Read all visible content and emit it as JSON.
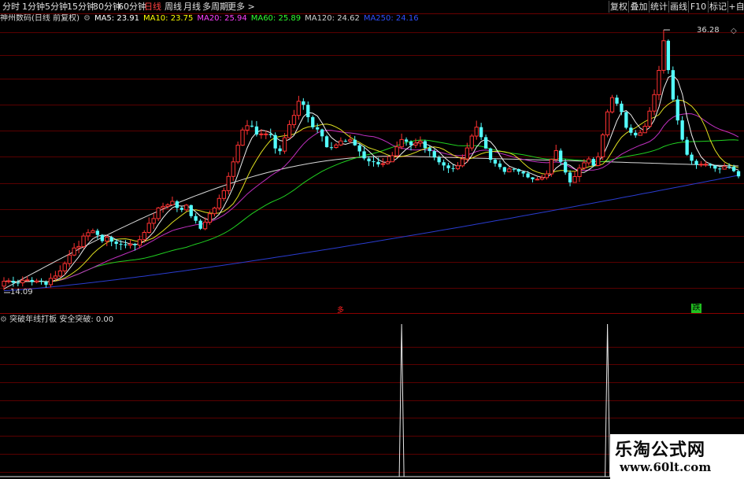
{
  "toolbar": {
    "tabs": [
      "分时",
      "1分钟",
      "5分钟",
      "15分钟",
      "30分钟",
      "60分钟",
      "日线",
      "周线",
      "月线",
      "多周期",
      "更多 >"
    ],
    "active_tab": "日线",
    "right_buttons": [
      "复权",
      "叠加",
      "统计",
      "画线",
      "F10",
      "标记",
      "+自选"
    ]
  },
  "stock": {
    "title": "神州数码(日线 前复权)"
  },
  "ma": [
    {
      "label": "MA5: 23.91",
      "color": "#ffffff"
    },
    {
      "label": "MA10: 23.75",
      "color": "#ffff00"
    },
    {
      "label": "MA20: 25.94",
      "color": "#ff00ff"
    },
    {
      "label": "MA60: 25.89",
      "color": "#00ff00"
    },
    {
      "label": "MA120: 24.62",
      "color": "#d0d0d0"
    },
    {
      "label": "MA250: 24.16",
      "color": "#3050ff"
    }
  ],
  "price_labels": {
    "high": "36.28",
    "low": "14.09"
  },
  "markers": {
    "buy": "多",
    "sell": "跌"
  },
  "indicator": {
    "label": "突破年线打板 安全突破: 0.00",
    "spikes": [
      {
        "candle": 85
      },
      {
        "candle": 129
      }
    ]
  },
  "colors": {
    "up": "#ff3232",
    "down": "#54ffff",
    "grid": "#5a0000",
    "ma250": "#2a3cd0"
  },
  "watermark": {
    "line1": "乐淘公式网",
    "line2": "www.60lt.com"
  },
  "chart_data": {
    "type": "candlestick",
    "y_high": 36.28,
    "y_low": 14.09,
    "candles": [
      [
        14.64,
        15.05,
        15.39,
        14.3
      ],
      [
        15.05,
        15.08,
        15.31,
        14.85
      ],
      [
        15.08,
        14.92,
        15.43,
        14.59
      ],
      [
        14.92,
        14.91,
        15.18,
        14.62
      ],
      [
        14.91,
        15.13,
        15.46,
        14.61
      ],
      [
        15.13,
        15.16,
        15.48,
        15.02
      ],
      [
        15.16,
        14.98,
        15.4,
        14.69
      ],
      [
        14.98,
        15.07,
        15.26,
        14.87
      ],
      [
        15.07,
        15.01,
        15.3,
        14.76
      ],
      [
        15.01,
        14.76,
        15.11,
        14.51
      ],
      [
        14.76,
        15.29,
        15.72,
        14.52
      ],
      [
        15.29,
        15.49,
        15.92,
        15.09
      ],
      [
        15.49,
        15.92,
        16.39,
        15.37
      ],
      [
        15.92,
        16.54,
        16.72,
        15.58
      ],
      [
        16.54,
        17.26,
        17.67,
        16.24
      ],
      [
        17.26,
        17.86,
        18.27,
        17.17
      ],
      [
        17.86,
        17.98,
        18.47,
        17.4
      ],
      [
        17.98,
        18.87,
        19.12,
        17.81
      ],
      [
        18.87,
        19.15,
        19.45,
        18.48
      ],
      [
        19.15,
        19.31,
        19.5,
        19.12
      ],
      [
        19.31,
        18.96,
        19.48,
        18.62
      ],
      [
        18.96,
        18.44,
        19.03,
        18.29
      ],
      [
        18.44,
        18.77,
        18.93,
        18.02
      ],
      [
        18.77,
        18.4,
        18.89,
        18.01
      ],
      [
        18.4,
        18.2,
        18.61,
        17.74
      ],
      [
        18.2,
        18.16,
        18.52,
        17.68
      ],
      [
        18.16,
        18.09,
        18.52,
        17.84
      ],
      [
        18.09,
        18.19,
        18.57,
        17.81
      ],
      [
        18.19,
        18.09,
        18.29,
        17.64
      ],
      [
        18.09,
        18.56,
        18.91,
        17.83
      ],
      [
        18.56,
        19.17,
        19.36,
        18.3
      ],
      [
        19.17,
        19.94,
        20.44,
        19.08
      ],
      [
        19.94,
        20.34,
        20.81,
        19.47
      ],
      [
        20.34,
        21.24,
        21.33,
        20.14
      ],
      [
        21.24,
        21.37,
        21.68,
        20.84
      ],
      [
        21.37,
        21.5,
        21.64,
        21.18
      ],
      [
        21.5,
        21.8,
        22.2,
        21.51
      ],
      [
        21.8,
        21.25,
        21.91,
        20.89
      ],
      [
        21.25,
        21.08,
        21.38,
        20.89
      ],
      [
        21.08,
        21.48,
        21.58,
        20.93
      ],
      [
        21.48,
        20.55,
        21.52,
        20.38
      ],
      [
        20.55,
        20.16,
        20.79,
        19.92
      ],
      [
        20.16,
        19.48,
        20.3,
        19.39
      ],
      [
        19.48,
        20.04,
        20.44,
        19.36
      ],
      [
        20.04,
        20.75,
        21.02,
        19.82
      ],
      [
        20.75,
        21.23,
        21.34,
        20.52
      ],
      [
        21.23,
        22.04,
        22.37,
        21.04
      ],
      [
        22.04,
        22.7,
        22.96,
        21.82
      ],
      [
        22.7,
        23.9,
        24.25,
        22.37
      ],
      [
        23.9,
        25.13,
        25.51,
        23.53
      ],
      [
        25.13,
        26.54,
        26.85,
        24.96
      ],
      [
        26.54,
        27.82,
        28.04,
        26.47
      ],
      [
        27.82,
        28.19,
        28.66,
        27.42
      ],
      [
        28.19,
        28.12,
        28.62,
        28.03
      ],
      [
        28.12,
        27.44,
        28.58,
        27.28
      ],
      [
        27.44,
        27.49,
        27.91,
        27.08
      ],
      [
        27.49,
        27.49,
        27.79,
        27.05
      ],
      [
        27.49,
        27.4,
        27.94,
        27.17
      ],
      [
        27.4,
        26.27,
        27.62,
        25.83
      ],
      [
        26.27,
        26.04,
        26.53,
        25.73
      ],
      [
        26.04,
        27.17,
        27.57,
        25.81
      ],
      [
        27.17,
        28.28,
        28.64,
        27.16
      ],
      [
        28.28,
        29.06,
        29.52,
        27.97
      ],
      [
        29.06,
        30.25,
        30.71,
        28.69
      ],
      [
        30.25,
        29.95,
        30.51,
        29.53
      ],
      [
        29.95,
        28.91,
        30.23,
        28.47
      ],
      [
        28.91,
        28.05,
        29.06,
        27.89
      ],
      [
        28.05,
        27.87,
        28.38,
        27.58
      ],
      [
        27.87,
        27.29,
        27.94,
        26.85
      ],
      [
        27.29,
        26.37,
        27.41,
        26.33
      ],
      [
        26.37,
        26.35,
        26.8,
        26.13
      ],
      [
        26.35,
        26.56,
        26.72,
        26.25
      ],
      [
        26.56,
        26.9,
        27.2,
        26.47
      ],
      [
        26.9,
        26.89,
        27.06,
        26.8
      ],
      [
        26.89,
        27.0,
        27.44,
        26.71
      ],
      [
        27.0,
        26.53,
        27.32,
        26.48
      ],
      [
        26.53,
        26.02,
        26.7,
        25.6
      ],
      [
        26.02,
        25.42,
        26.46,
        25.27
      ],
      [
        25.42,
        25.18,
        25.61,
        24.78
      ],
      [
        25.18,
        25.13,
        25.6,
        24.73
      ],
      [
        25.13,
        24.92,
        25.49,
        24.7
      ],
      [
        24.92,
        24.98,
        25.45,
        24.69
      ],
      [
        24.98,
        25.14,
        25.65,
        24.9
      ],
      [
        25.14,
        25.65,
        25.97,
        25.2
      ],
      [
        25.65,
        26.4,
        26.85,
        25.5
      ],
      [
        26.4,
        27.02,
        27.52,
        26.2
      ],
      [
        27.02,
        26.84,
        27.2,
        26.5
      ],
      [
        26.84,
        26.55,
        26.95,
        26.1
      ],
      [
        26.55,
        26.72,
        27.1,
        26.3
      ],
      [
        26.72,
        26.88,
        27.28,
        26.4
      ],
      [
        26.88,
        26.3,
        27.0,
        25.9
      ],
      [
        26.3,
        26.04,
        26.5,
        25.6
      ],
      [
        26.04,
        25.51,
        26.2,
        25.26
      ],
      [
        25.51,
        25.1,
        25.68,
        24.88
      ],
      [
        25.1,
        24.83,
        25.33,
        24.4
      ],
      [
        24.83,
        24.6,
        25.05,
        24.19
      ],
      [
        24.6,
        24.55,
        24.9,
        24.28
      ],
      [
        24.55,
        24.8,
        25.12,
        24.44
      ],
      [
        24.8,
        25.38,
        25.76,
        24.67
      ],
      [
        25.38,
        26.31,
        26.74,
        25.06
      ],
      [
        26.31,
        27.31,
        27.5,
        26.07
      ],
      [
        27.31,
        28.06,
        28.61,
        27.0
      ],
      [
        28.06,
        27.22,
        28.43,
        26.98
      ],
      [
        27.22,
        26.26,
        27.44,
        26.23
      ],
      [
        26.26,
        25.31,
        26.34,
        25.05
      ],
      [
        25.31,
        24.99,
        25.45,
        24.73
      ],
      [
        24.99,
        24.69,
        25.26,
        24.49
      ],
      [
        24.69,
        24.29,
        24.72,
        24.07
      ],
      [
        24.29,
        24.54,
        24.72,
        24.33
      ],
      [
        24.54,
        24.52,
        24.6,
        24.28
      ],
      [
        24.52,
        24.31,
        24.57,
        24.05
      ],
      [
        24.31,
        24.16,
        24.35,
        23.85
      ],
      [
        24.16,
        23.82,
        24.36,
        23.75
      ],
      [
        23.82,
        23.67,
        23.84,
        23.4
      ],
      [
        23.67,
        23.67,
        23.86,
        23.57
      ],
      [
        23.67,
        23.8,
        24.05,
        23.56
      ],
      [
        23.8,
        24.12,
        24.41,
        23.63
      ],
      [
        24.12,
        25.34,
        25.41,
        23.87
      ],
      [
        25.34,
        26.08,
        26.58,
        25.16
      ],
      [
        26.08,
        25.13,
        26.27,
        24.84
      ],
      [
        25.13,
        24.23,
        25.37,
        24.04
      ],
      [
        24.23,
        23.4,
        24.42,
        23.07
      ],
      [
        23.4,
        23.89,
        24.34,
        23.46
      ],
      [
        23.89,
        24.61,
        24.91,
        23.43
      ],
      [
        24.61,
        25.05,
        25.37,
        24.47
      ],
      [
        25.05,
        25.38,
        25.59,
        24.82
      ],
      [
        25.38,
        24.82,
        25.52,
        24.7
      ],
      [
        24.82,
        25.56,
        25.94,
        24.76
      ],
      [
        25.56,
        27.41,
        27.57,
        25.28
      ],
      [
        27.41,
        29.35,
        29.56,
        27.21
      ],
      [
        29.35,
        30.56,
        30.79,
        29.22
      ],
      [
        30.56,
        30.05,
        30.79,
        29.86
      ],
      [
        30.05,
        29.34,
        30.28,
        29.07
      ],
      [
        29.34,
        28.02,
        29.38,
        27.88
      ],
      [
        28.02,
        27.59,
        28.3,
        27.36
      ],
      [
        27.59,
        27.37,
        27.82,
        27.17
      ],
      [
        27.37,
        27.59,
        27.85,
        27.41
      ],
      [
        27.59,
        28.14,
        28.42,
        27.64
      ],
      [
        28.14,
        29.42,
        29.76,
        28.0
      ],
      [
        29.42,
        30.81,
        31.25,
        29.06
      ],
      [
        30.81,
        32.86,
        33.24,
        30.35
      ],
      [
        32.86,
        35.36,
        36.28,
        32.59
      ],
      [
        35.36,
        32.88,
        35.48,
        32.57
      ],
      [
        32.88,
        30.4,
        33.19,
        30.26
      ],
      [
        30.4,
        28.63,
        30.73,
        28.27
      ],
      [
        28.63,
        27.0,
        28.99,
        26.88
      ],
      [
        27.0,
        25.74,
        27.25,
        25.64
      ],
      [
        25.74,
        25.22,
        25.94,
        24.88
      ],
      [
        25.22,
        24.89,
        25.36,
        24.54
      ],
      [
        24.89,
        24.93,
        25.2,
        24.7
      ],
      [
        24.93,
        24.93,
        25.2,
        24.71
      ],
      [
        24.93,
        24.82,
        25.02,
        24.6
      ],
      [
        24.82,
        24.57,
        24.87,
        24.29
      ],
      [
        24.57,
        24.51,
        24.7,
        24.16
      ],
      [
        24.51,
        24.73,
        25.04,
        24.48
      ],
      [
        24.73,
        24.71,
        25.01,
        24.52
      ],
      [
        24.71,
        24.35,
        24.89,
        24.26
      ],
      [
        24.35,
        23.91,
        24.42,
        23.75
      ]
    ]
  }
}
